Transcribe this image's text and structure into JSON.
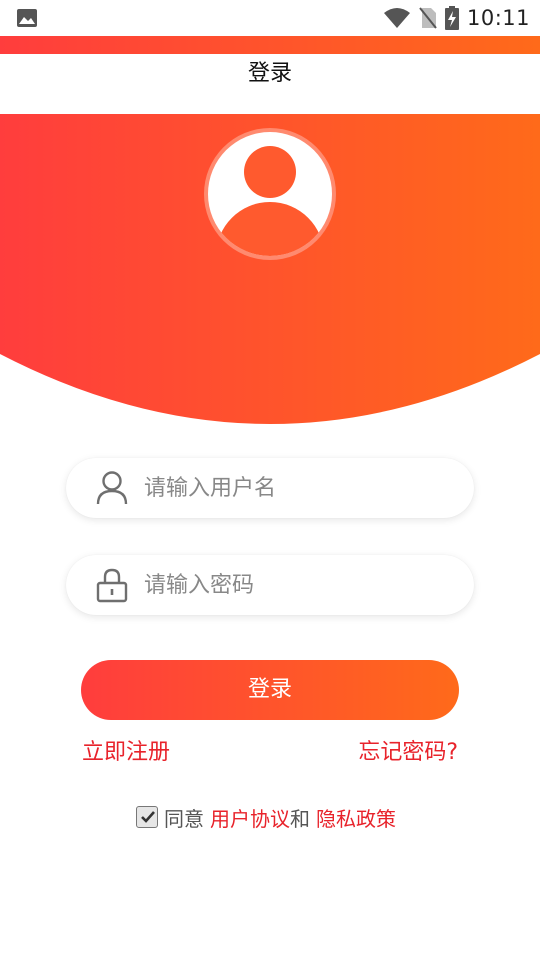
{
  "status_bar": {
    "time": "10:11",
    "icons": [
      "image-icon",
      "wifi-icon",
      "no-sim-icon",
      "battery-charging-icon"
    ]
  },
  "header": {
    "title": "登录"
  },
  "form": {
    "username": {
      "placeholder": "请输入用户名",
      "value": "",
      "icon": "user-icon"
    },
    "password": {
      "placeholder": "请输入密码",
      "value": "",
      "icon": "lock-icon"
    },
    "login_label": "登录",
    "register_label": "立即注册",
    "forgot_label": "忘记密码?"
  },
  "agreement": {
    "checked": true,
    "prefix": "同意",
    "user_agreement": "用户协议",
    "conjunction": "和",
    "privacy_policy": "隐私政策"
  },
  "colors": {
    "gradient_start": "#ff3d3d",
    "gradient_end": "#ff6a1a",
    "link_red": "#e8232b"
  }
}
